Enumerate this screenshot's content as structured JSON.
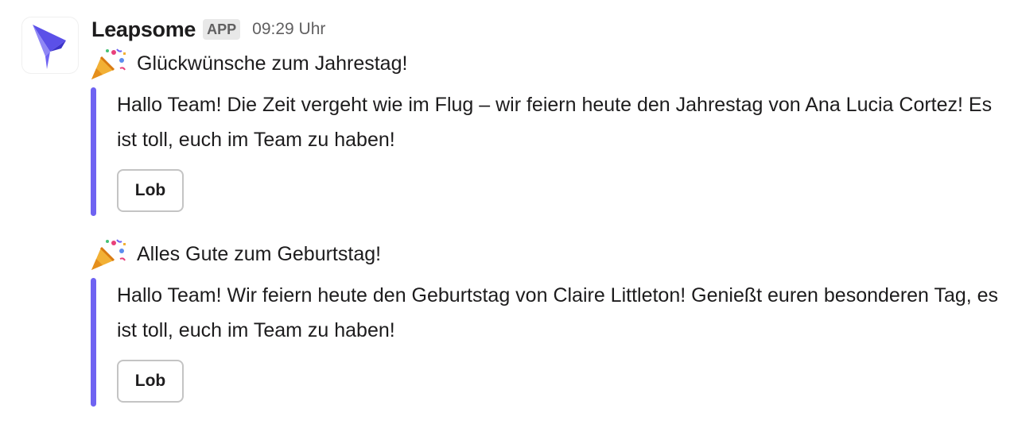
{
  "message": {
    "app_name": "Leapsome",
    "badge": "APP",
    "timestamp": "09:29 Uhr",
    "avatar_icon": "leapsome-logo-icon"
  },
  "posts": [
    {
      "emoji": "🎉",
      "emoji_icon": "party-popper-icon",
      "title": "Glückwünsche zum Jahrestag!",
      "body": "Hallo Team! Die Zeit vergeht wie im Flug – wir feiern heute den Jahrestag von Ana Lucia Cortez! Es ist toll, euch im Team zu haben!",
      "button_label": "Lob"
    },
    {
      "emoji": "🎉",
      "emoji_icon": "party-popper-icon",
      "title": "Alles Gute zum Geburtstag!",
      "body": "Hallo Team! Wir feiern heute den Geburtstag von Claire Littleton! Genießt euren besonderen Tag, es ist toll, euch im Team zu haben!",
      "button_label": "Lob"
    }
  ],
  "colors": {
    "accent_bar": "#6f63f2",
    "badge_bg": "#e8e8e8",
    "muted_text": "#616061"
  }
}
